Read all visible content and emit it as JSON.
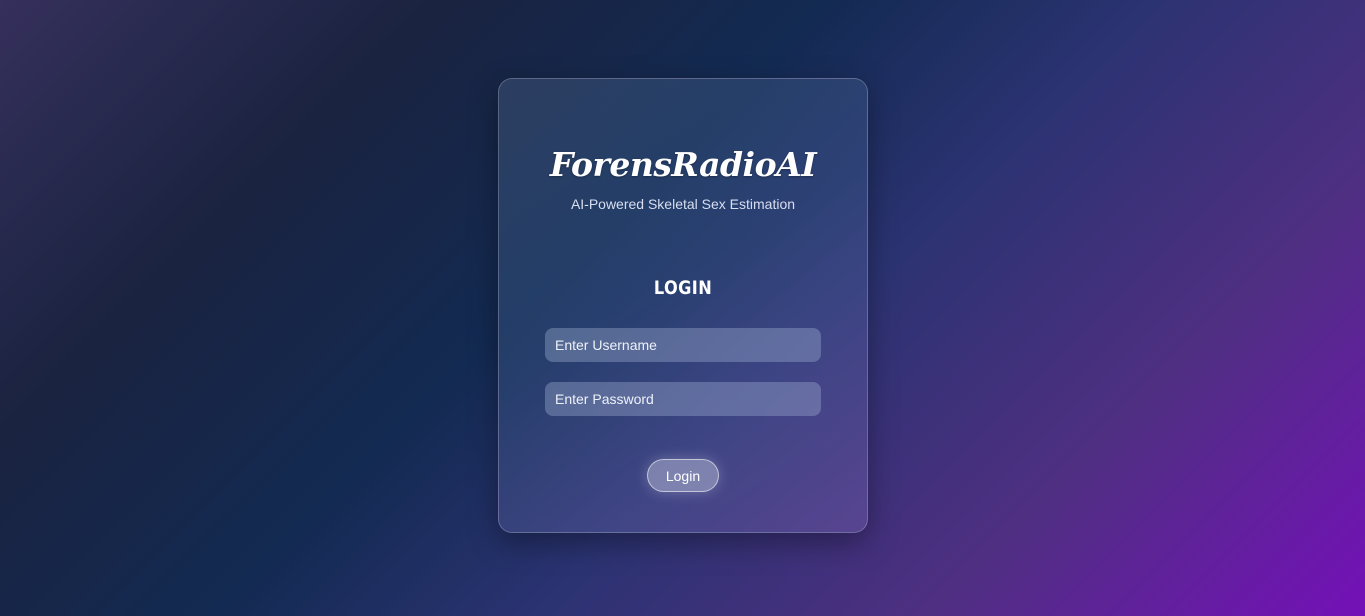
{
  "brand": {
    "title": "ForensRadioAI",
    "subtitle": "AI-Powered Skeletal Sex Estimation"
  },
  "login_form": {
    "heading": "LOGIN",
    "username": {
      "value": "",
      "placeholder": "Enter Username"
    },
    "password": {
      "value": "",
      "placeholder": "Enter Password"
    },
    "submit_label": "Login"
  },
  "colors": {
    "background_start": "#35305c",
    "background_mid": "#132a52",
    "background_end": "#7410b8",
    "text": "#ffffff"
  }
}
